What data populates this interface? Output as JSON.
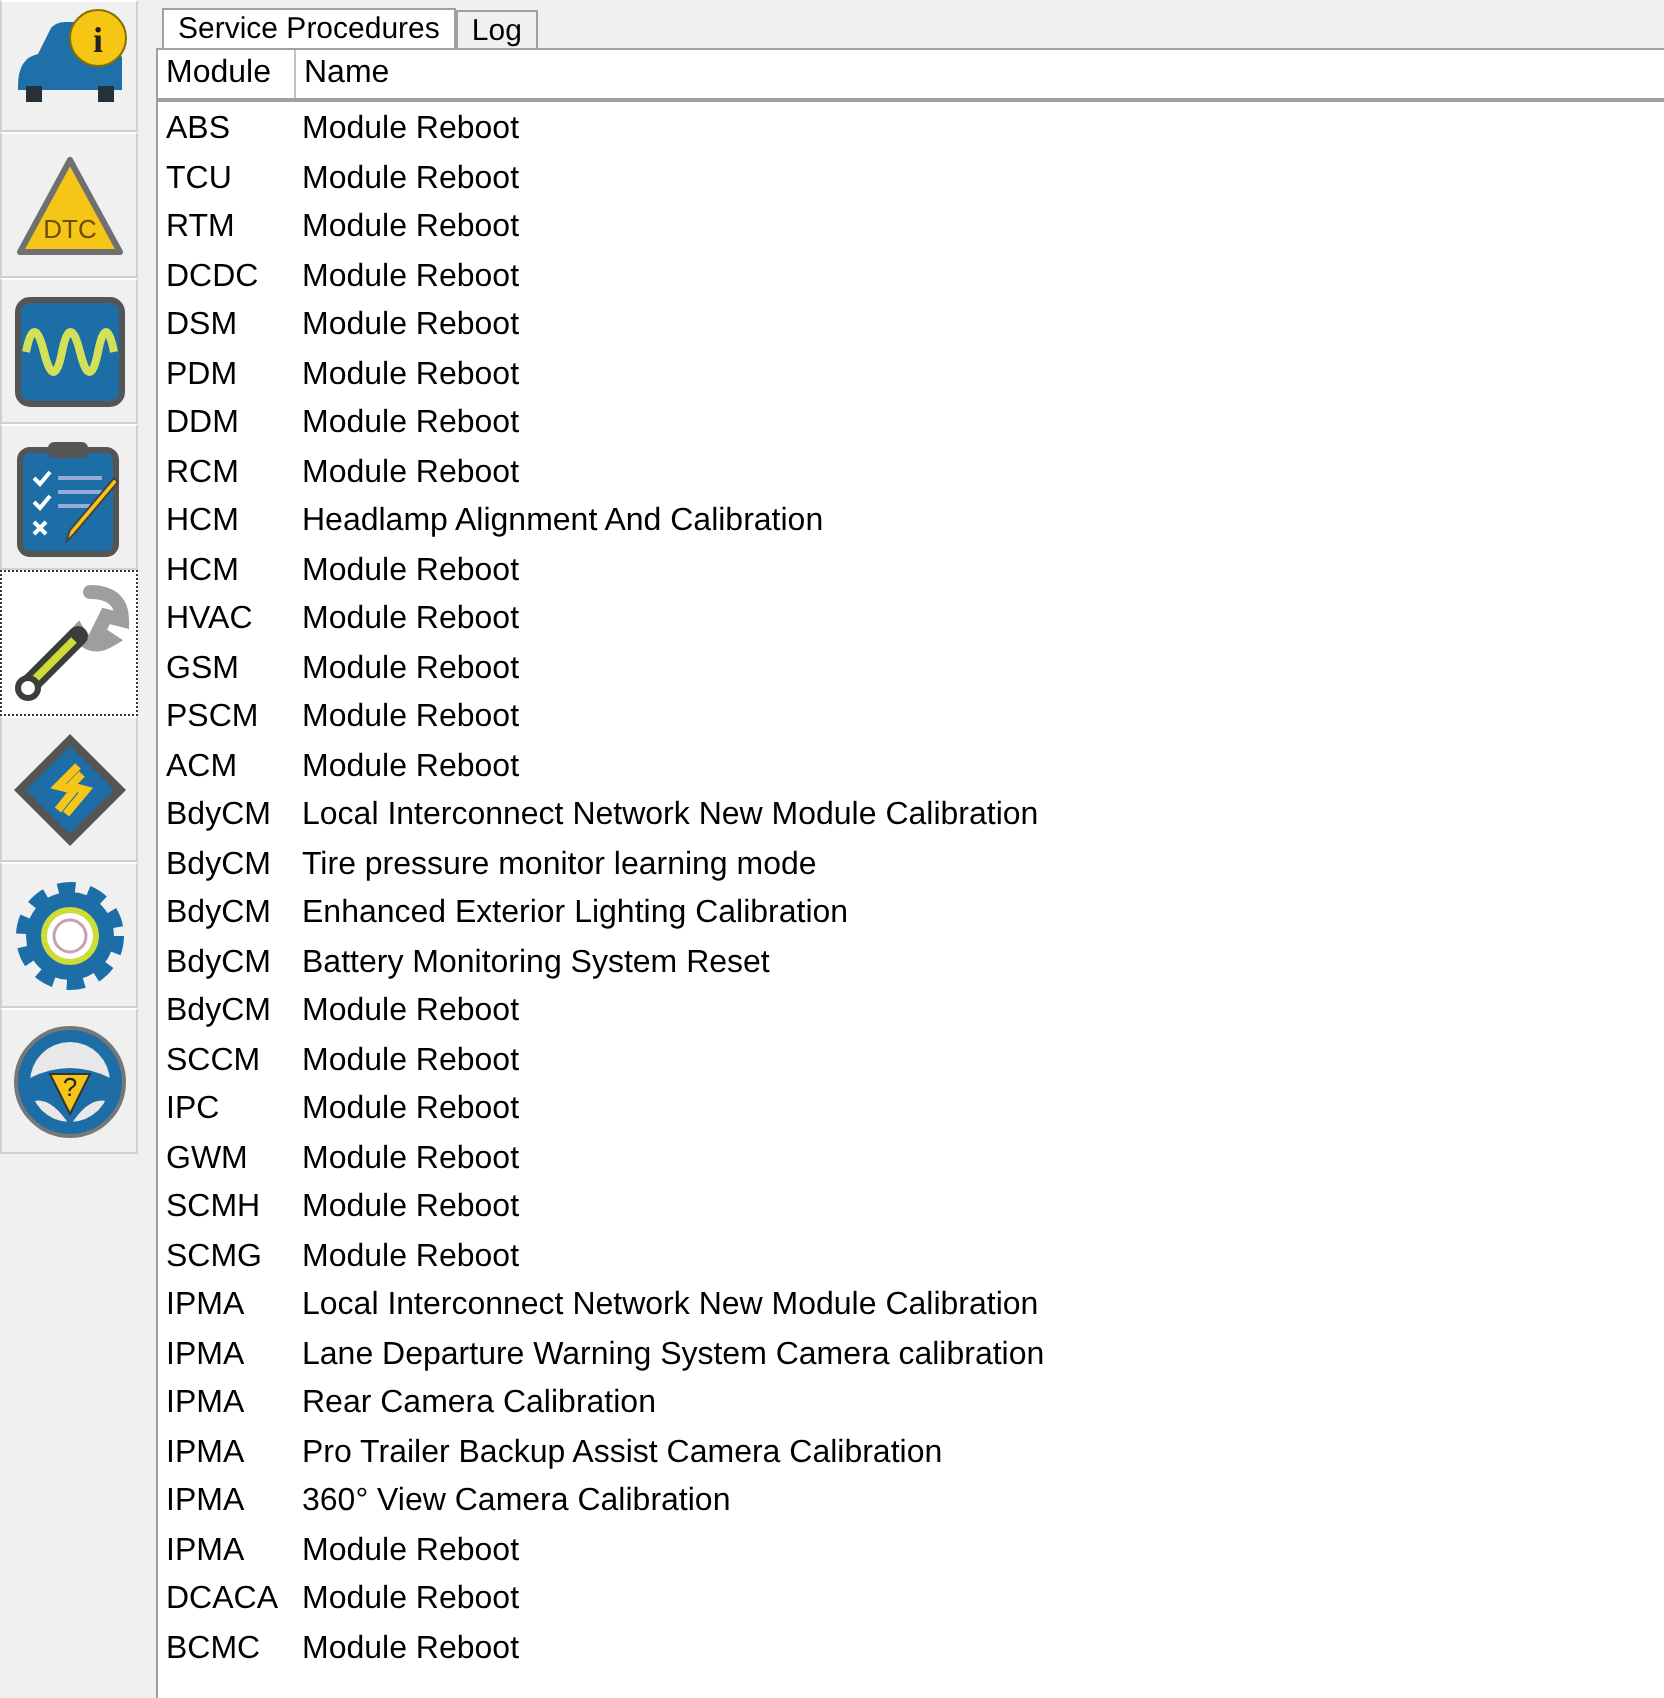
{
  "sidebar": {
    "items": [
      {
        "kind": "info",
        "glyph": "i",
        "selected": false
      },
      {
        "kind": "dtc",
        "glyph": "DTC",
        "selected": false
      },
      {
        "kind": "scope",
        "selected": false
      },
      {
        "kind": "checklist",
        "selected": false
      },
      {
        "kind": "wrench",
        "selected": true
      },
      {
        "kind": "chip",
        "selected": false
      },
      {
        "kind": "gear",
        "selected": false
      },
      {
        "kind": "help",
        "glyph": "?",
        "selected": false
      }
    ]
  },
  "tabs": [
    {
      "label": "Service Procedures",
      "selected": true
    },
    {
      "label": "Log",
      "selected": false
    }
  ],
  "table": {
    "columns": [
      "Module",
      "Name"
    ],
    "rows": [
      [
        "ABS",
        "Module Reboot"
      ],
      [
        "TCU",
        "Module Reboot"
      ],
      [
        "RTM",
        "Module Reboot"
      ],
      [
        "DCDC",
        "Module Reboot"
      ],
      [
        "DSM",
        "Module Reboot"
      ],
      [
        "PDM",
        "Module Reboot"
      ],
      [
        "DDM",
        "Module Reboot"
      ],
      [
        "RCM",
        "Module Reboot"
      ],
      [
        "HCM",
        "Headlamp Alignment And Calibration"
      ],
      [
        "HCM",
        "Module Reboot"
      ],
      [
        "HVAC",
        "Module Reboot"
      ],
      [
        "GSM",
        "Module Reboot"
      ],
      [
        "PSCM",
        "Module Reboot"
      ],
      [
        "ACM",
        "Module Reboot"
      ],
      [
        "BdyCM",
        "Local Interconnect Network New Module Calibration"
      ],
      [
        "BdyCM",
        "Tire pressure monitor learning mode"
      ],
      [
        "BdyCM",
        "Enhanced Exterior Lighting Calibration"
      ],
      [
        "BdyCM",
        "Battery Monitoring System Reset"
      ],
      [
        "BdyCM",
        "Module Reboot"
      ],
      [
        "SCCM",
        "Module Reboot"
      ],
      [
        "IPC",
        "Module Reboot"
      ],
      [
        "GWM",
        "Module Reboot"
      ],
      [
        "SCMH",
        "Module Reboot"
      ],
      [
        "SCMG",
        "Module Reboot"
      ],
      [
        "IPMA",
        "Local Interconnect Network New Module Calibration"
      ],
      [
        "IPMA",
        "Lane Departure Warning System Camera calibration"
      ],
      [
        "IPMA",
        "Rear Camera Calibration"
      ],
      [
        "IPMA",
        "Pro Trailer Backup Assist Camera Calibration"
      ],
      [
        "IPMA",
        "360° View Camera Calibration"
      ],
      [
        "IPMA",
        "Module Reboot"
      ],
      [
        "DCACA",
        "Module Reboot"
      ],
      [
        "BCMC",
        "Module Reboot"
      ]
    ]
  }
}
